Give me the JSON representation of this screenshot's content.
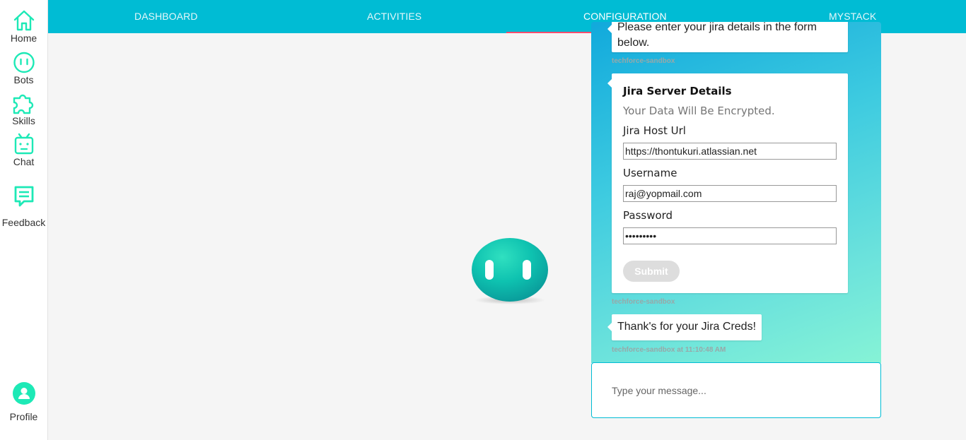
{
  "sidebar": {
    "items": [
      {
        "label": "Home",
        "icon": "home-icon"
      },
      {
        "label": "Bots",
        "icon": "bot-face-icon"
      },
      {
        "label": "Skills",
        "icon": "puzzle-icon"
      },
      {
        "label": "Chat",
        "icon": "robot-icon"
      },
      {
        "label": "Feedback",
        "icon": "message-icon"
      }
    ],
    "profile": {
      "label": "Profile",
      "icon": "user-icon"
    }
  },
  "nav": {
    "tabs": [
      "DASHBOARD",
      "ACTIVITIES",
      "CONFIGURATION",
      "MYSTACK"
    ],
    "active": "CONFIGURATION"
  },
  "colors": {
    "primary": "#00bcd4",
    "accent_green": "#1de9b6",
    "tab_underline": "#ff4d6d"
  },
  "chat": {
    "messages": [
      {
        "text": "Please enter your jira details in the form below.",
        "sender": "techforce-sandbox"
      },
      {
        "type": "form",
        "title": "Jira Server Details",
        "subtitle": "Your Data Will Be Encrypted.",
        "fields": [
          {
            "label": "Jira Host Url",
            "value": "https://thontukuri.atlassian.net"
          },
          {
            "label": "Username",
            "value": "raj@yopmail.com"
          },
          {
            "label": "Password",
            "value": "•••••••••"
          }
        ],
        "submit_label": "Submit",
        "sender": "techforce-sandbox"
      },
      {
        "text": "Thank's for your Jira Creds!",
        "sender": "techforce-sandbox at 11:10:48 AM"
      }
    ],
    "input_placeholder": "Type your message..."
  }
}
